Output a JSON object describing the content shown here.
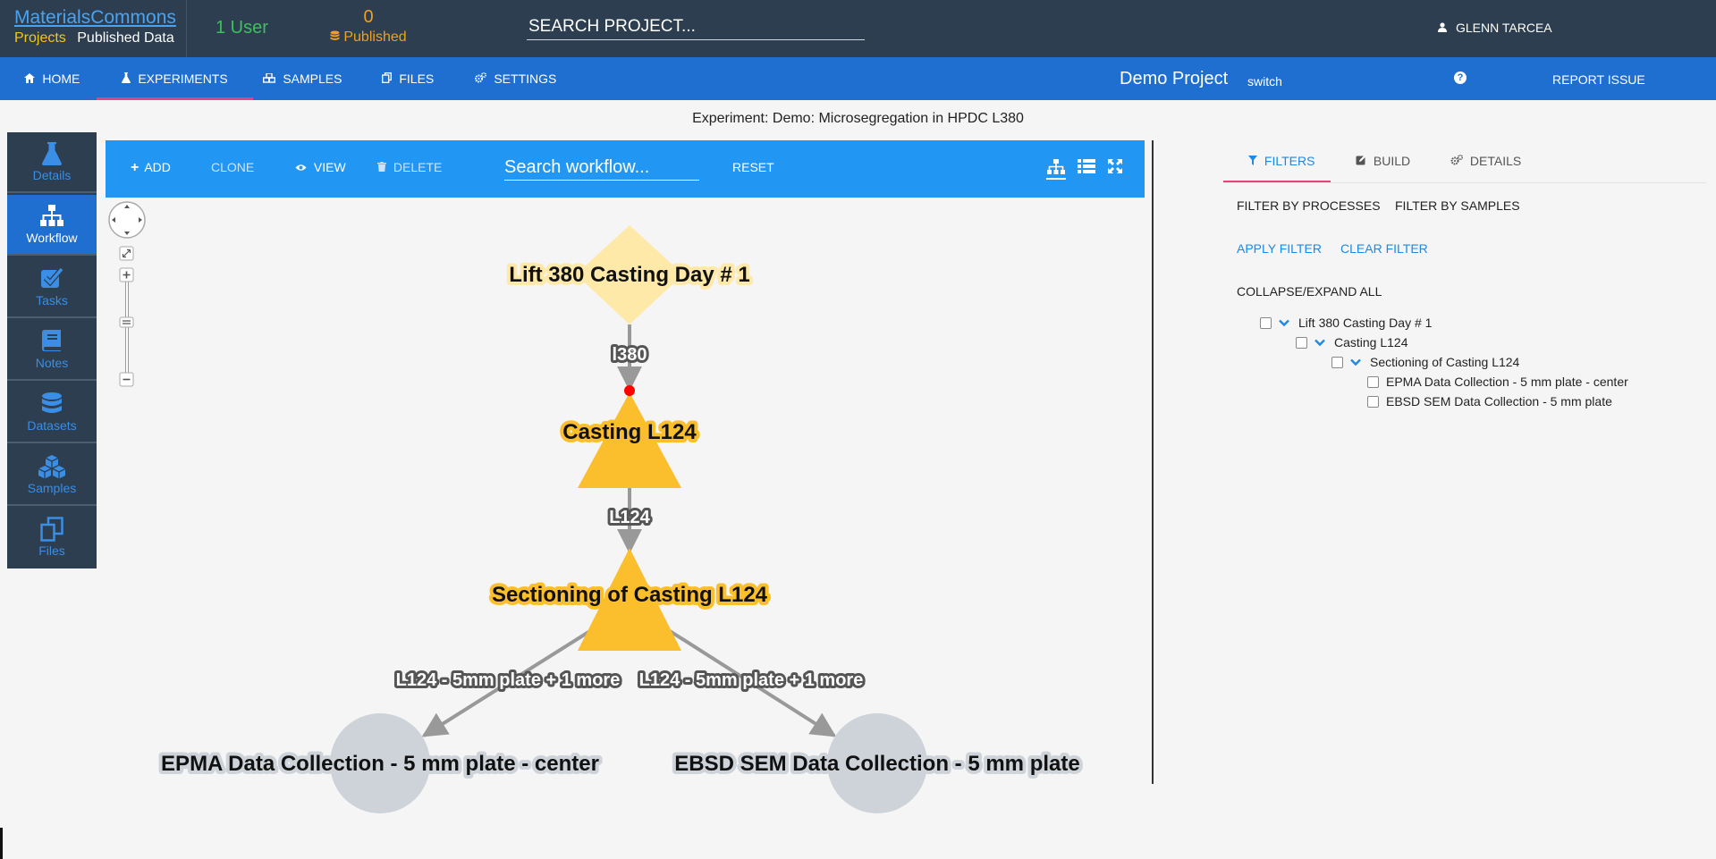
{
  "brand": {
    "name": "MaterialsCommons",
    "projects": "Projects",
    "published_data": "Published Data"
  },
  "stats": {
    "users": "1 User",
    "published_count": "0",
    "published_label": "Published"
  },
  "search": {
    "placeholder": "SEARCH PROJECT..."
  },
  "user": {
    "name": "GLENN TARCEA"
  },
  "nav": {
    "items": [
      {
        "label": "HOME",
        "icon": "home-icon"
      },
      {
        "label": "EXPERIMENTS",
        "icon": "flask-icon"
      },
      {
        "label": "SAMPLES",
        "icon": "cubes-icon"
      },
      {
        "label": "FILES",
        "icon": "files-icon"
      },
      {
        "label": "SETTINGS",
        "icon": "gears-icon"
      }
    ],
    "active": "EXPERIMENTS",
    "project": "Demo Project",
    "switch": "switch",
    "report": "REPORT ISSUE"
  },
  "experiment_title": "Experiment: Demo: Microsegregation in HPDC L380",
  "sidebar": {
    "items": [
      {
        "label": "Details",
        "icon": "flask-icon"
      },
      {
        "label": "Workflow",
        "icon": "sitemap-icon"
      },
      {
        "label": "Tasks",
        "icon": "checkbox-icon"
      },
      {
        "label": "Notes",
        "icon": "book-icon"
      },
      {
        "label": "Datasets",
        "icon": "database-icon"
      },
      {
        "label": "Samples",
        "icon": "cubes-icon"
      },
      {
        "label": "Files",
        "icon": "files-icon"
      }
    ],
    "active": "Workflow"
  },
  "toolbar": {
    "add": "ADD",
    "clone": "CLONE",
    "view": "VIEW",
    "delete": "DELETE",
    "search_placeholder": "Search workflow...",
    "reset": "RESET"
  },
  "workflow": {
    "nodes": {
      "casting_day": "Lift 380 Casting Day  # 1",
      "casting": "Casting L124",
      "sectioning": "Sectioning of Casting L124",
      "epma": "EPMA Data Collection - 5 mm plate - center",
      "ebsd": "EBSD SEM Data Collection - 5 mm plate"
    },
    "edges": {
      "e1": "l380",
      "e2": "L124",
      "e3": "L124 - 5mm plate + 1 more",
      "e4": "L124 - 5mm plate + 1 more"
    },
    "colors": {
      "diamond": "#ffe9a8",
      "triangle": "#fbbf2d",
      "circle": "#cdd3d8",
      "edge": "#999999",
      "marker": "#ff0000"
    }
  },
  "panel": {
    "tabs": [
      {
        "label": "FILTERS",
        "icon": "filter-icon"
      },
      {
        "label": "BUILD",
        "icon": "edit-icon"
      },
      {
        "label": "DETAILS",
        "icon": "gears-icon"
      }
    ],
    "active_tab": "FILTERS",
    "filter_processes": "FILTER BY PROCESSES",
    "filter_samples": "FILTER BY SAMPLES",
    "apply": "APPLY FILTER",
    "clear": "CLEAR FILTER",
    "collapse": "COLLAPSE/EXPAND ALL",
    "tree": [
      {
        "label": "Lift 380 Casting Day # 1",
        "expanded": true
      },
      {
        "label": "Casting L124",
        "expanded": true
      },
      {
        "label": "Sectioning of Casting L124",
        "expanded": true
      },
      {
        "label": "EPMA Data Collection - 5 mm plate - center",
        "expanded": false
      },
      {
        "label": "EBSD SEM Data Collection - 5 mm plate",
        "expanded": false
      }
    ]
  }
}
